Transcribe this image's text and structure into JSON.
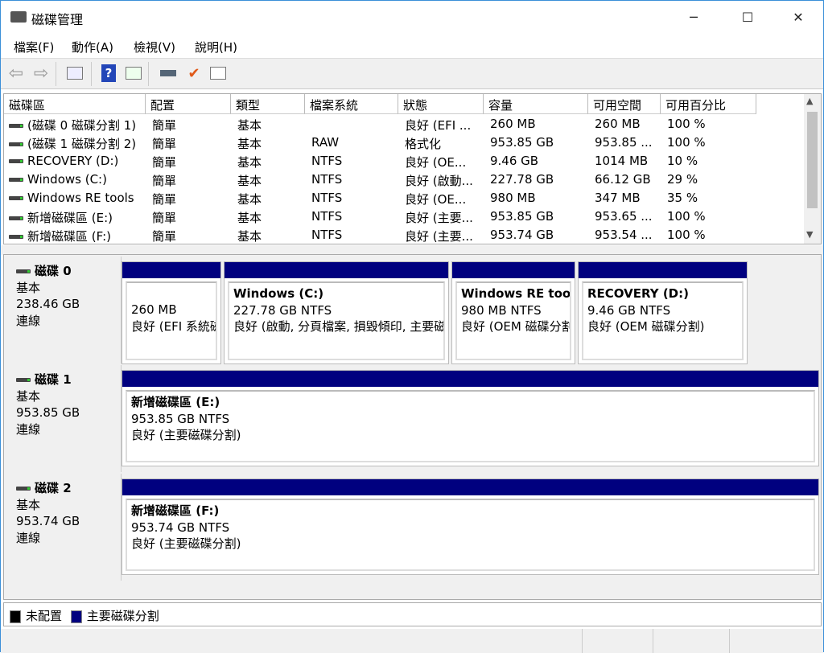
{
  "window": {
    "title": "磁碟管理",
    "minimize": "─",
    "maximize": "☐",
    "close": "✕"
  },
  "menu": [
    "檔案(F)",
    "動作(A)",
    "檢視(V)",
    "說明(H)"
  ],
  "list": {
    "headers": [
      "磁碟區",
      "配置",
      "類型",
      "檔案系統",
      "狀態",
      "容量",
      "可用空間",
      "可用百分比"
    ],
    "rows": [
      [
        "(磁碟 0 磁碟分割 1)",
        "簡單",
        "基本",
        "",
        "良好 (EFI ...",
        "260 MB",
        "260 MB",
        "100 %"
      ],
      [
        "(磁碟 1 磁碟分割 2)",
        "簡單",
        "基本",
        "RAW",
        "格式化",
        "953.85 GB",
        "953.85 ...",
        "100 %"
      ],
      [
        "RECOVERY (D:)",
        "簡單",
        "基本",
        "NTFS",
        "良好 (OE...",
        "9.46 GB",
        "1014 MB",
        "10 %"
      ],
      [
        "Windows (C:)",
        "簡單",
        "基本",
        "NTFS",
        "良好 (啟動...",
        "227.78 GB",
        "66.12 GB",
        "29 %"
      ],
      [
        "Windows RE tools",
        "簡單",
        "基本",
        "NTFS",
        "良好 (OE...",
        "980 MB",
        "347 MB",
        "35 %"
      ],
      [
        "新增磁碟區 (E:)",
        "簡單",
        "基本",
        "NTFS",
        "良好 (主要...",
        "953.85 GB",
        "953.65 ...",
        "100 %"
      ],
      [
        "新增磁碟區 (F:)",
        "簡單",
        "基本",
        "NTFS",
        "良好 (主要...",
        "953.74 GB",
        "953.54 ...",
        "100 %"
      ]
    ]
  },
  "disks": [
    {
      "name": "磁碟 0",
      "type": "基本",
      "size": "238.46 GB",
      "status": "連線",
      "partitions": [
        {
          "name": "",
          "size": "260 MB",
          "status": "良好 (EFI 系統磁碟分割)"
        },
        {
          "name": "Windows  (C:)",
          "size": "227.78 GB NTFS",
          "status": "良好 (啟動, 分頁檔案, 損毀傾印, 主要磁碟分割)"
        },
        {
          "name": "Windows RE tools",
          "size": "980 MB NTFS",
          "status": "良好 (OEM 磁碟分割)"
        },
        {
          "name": "RECOVERY  (D:)",
          "size": "9.46 GB NTFS",
          "status": "良好 (OEM 磁碟分割)"
        }
      ]
    },
    {
      "name": "磁碟 1",
      "type": "基本",
      "size": "953.85 GB",
      "status": "連線",
      "partitions": [
        {
          "name": "新增磁碟區  (E:)",
          "size": "953.85 GB NTFS",
          "status": "良好 (主要磁碟分割)"
        }
      ]
    },
    {
      "name": "磁碟 2",
      "type": "基本",
      "size": "953.74 GB",
      "status": "連線",
      "partitions": [
        {
          "name": "新增磁碟區  (F:)",
          "size": "953.74 GB NTFS",
          "status": "良好 (主要磁碟分割)"
        }
      ]
    }
  ],
  "legend": [
    {
      "label": "未配置",
      "color": "#000000"
    },
    {
      "label": "主要磁碟分割",
      "color": "#00007f"
    }
  ]
}
